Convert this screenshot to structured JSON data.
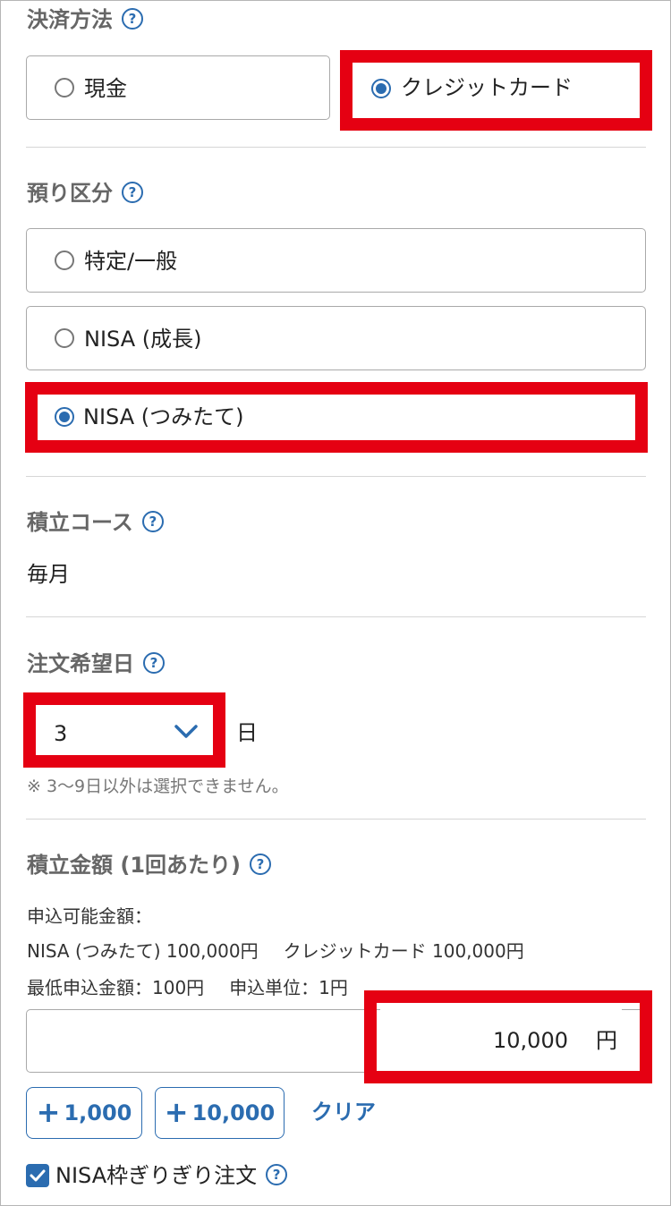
{
  "payment": {
    "label": "決済方法",
    "help_icon": "?",
    "options": [
      {
        "label": "現金",
        "selected": false
      },
      {
        "label": "クレジットカード",
        "selected": true
      }
    ]
  },
  "account": {
    "label": "預り区分",
    "help_icon": "?",
    "options": [
      {
        "label": "特定/一般",
        "selected": false
      },
      {
        "label": "NISA (成長)",
        "selected": false
      },
      {
        "label": "NISA (つみたて)",
        "selected": true
      }
    ]
  },
  "course": {
    "label": "積立コース",
    "help_icon": "?",
    "value": "毎月"
  },
  "order_day": {
    "label": "注文希望日",
    "help_icon": "?",
    "selected": "3",
    "unit": "日",
    "note": "※ 3〜9日以外は選択できません。"
  },
  "amount": {
    "label": "積立金額 (1回あたり)",
    "help_icon": "?",
    "available_label": "申込可能金額：",
    "available_nisa": "NISA (つみたて) 100,000円",
    "available_card": "クレジットカード 100,000円",
    "minimum": "最低申込金額：100円",
    "unit_step": "申込単位：1円",
    "value": "10,000",
    "currency": "円",
    "add_1000": "1,000",
    "add_10000": "10,000",
    "plus_symbol": "+",
    "clear": "クリア"
  },
  "nisa_limit": {
    "label": "NISA枠ぎりぎり注文",
    "checked": true,
    "help_icon": "?"
  },
  "colors": {
    "accent": "#2b6cb0",
    "highlight": "#e50012",
    "checkbox": "#2b6cb0"
  }
}
